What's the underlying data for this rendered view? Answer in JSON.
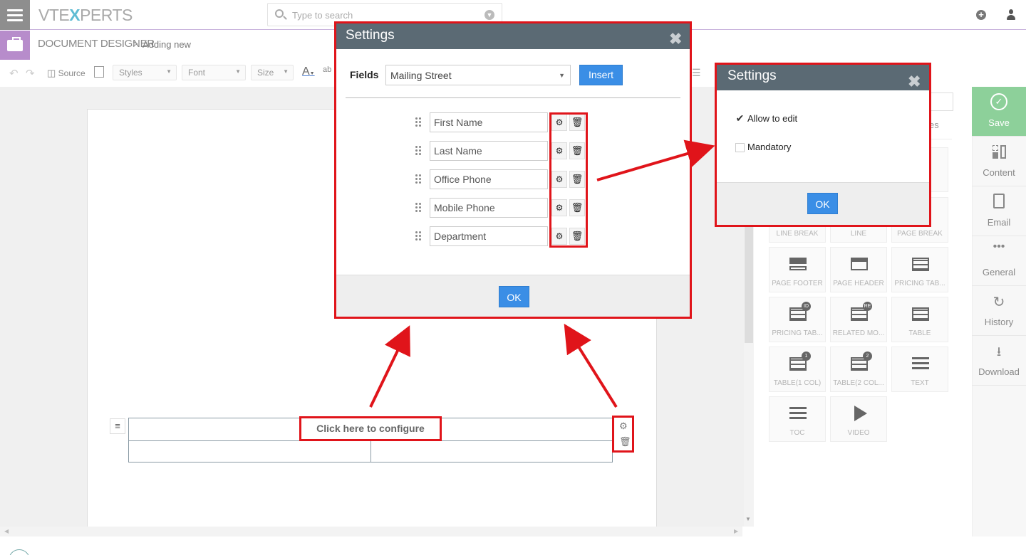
{
  "topbar": {
    "logo_left": "VTE",
    "logo_x": "X",
    "logo_right": "PERTS",
    "search_placeholder": "Type to search"
  },
  "breadcrumb": {
    "module": "DOCUMENT DESIGNER",
    "separator": ">",
    "current": "Adding new"
  },
  "toolbar": {
    "source_label": "Source",
    "styles_label": "Styles",
    "font_label": "Font",
    "size_label": "Size",
    "text_color_label": "A"
  },
  "canvas": {
    "configure_label": "Click here to configure"
  },
  "settings_dialog": {
    "title": "Settings",
    "fields_label": "Fields",
    "selected_field": "Mailing Street",
    "insert_label": "Insert",
    "fields": [
      "First Name",
      "Last Name",
      "Office Phone",
      "Mobile Phone",
      "Department"
    ],
    "ok_label": "OK"
  },
  "field_settings_dialog": {
    "title": "Settings",
    "allow_edit_label": "Allow to edit",
    "allow_edit_checked": true,
    "mandatory_label": "Mandatory",
    "mandatory_checked": false,
    "ok_label": "OK"
  },
  "right_panel": {
    "partial_text": "es",
    "blocks": [
      {
        "label": "LINE BREAK",
        "icon": "line-break-icon"
      },
      {
        "label": "LINE",
        "icon": "line-icon"
      },
      {
        "label": "PAGE BREAK",
        "icon": "page-break-icon"
      },
      {
        "label": "PAGE FOOTER",
        "icon": "page-footer-icon"
      },
      {
        "label": "PAGE HEADER",
        "icon": "page-header-icon"
      },
      {
        "label": "PRICING TAB...",
        "icon": "pricing-table-icon"
      },
      {
        "label": "PRICING TAB...",
        "icon": "pricing-table-id-icon",
        "badge": "ID"
      },
      {
        "label": "RELATED MO...",
        "icon": "related-module-icon",
        "badge": "RE"
      },
      {
        "label": "TABLE",
        "icon": "table-icon"
      },
      {
        "label": "TABLE(1 COL)",
        "icon": "table-1col-icon",
        "badge": "1"
      },
      {
        "label": "TABLE(2 COL...",
        "icon": "table-2col-icon",
        "badge": "2"
      },
      {
        "label": "TEXT",
        "icon": "text-icon"
      },
      {
        "label": "TOC",
        "icon": "toc-icon"
      },
      {
        "label": "VIDEO",
        "icon": "video-icon"
      }
    ]
  },
  "side_nav": [
    {
      "label": "Save",
      "icon": "check-circle-icon"
    },
    {
      "label": "Content",
      "icon": "content-icon"
    },
    {
      "label": "Email",
      "icon": "email-icon"
    },
    {
      "label": "General",
      "icon": "dots-icon"
    },
    {
      "label": "History",
      "icon": "history-icon"
    },
    {
      "label": "Download",
      "icon": "download-icon"
    }
  ],
  "colors": {
    "accent_red": "#e0141a",
    "primary_blue": "#3a8ee6",
    "dialog_header": "#5b6a74",
    "save_green": "#8dd09a",
    "module_purple": "#b78ccb"
  }
}
